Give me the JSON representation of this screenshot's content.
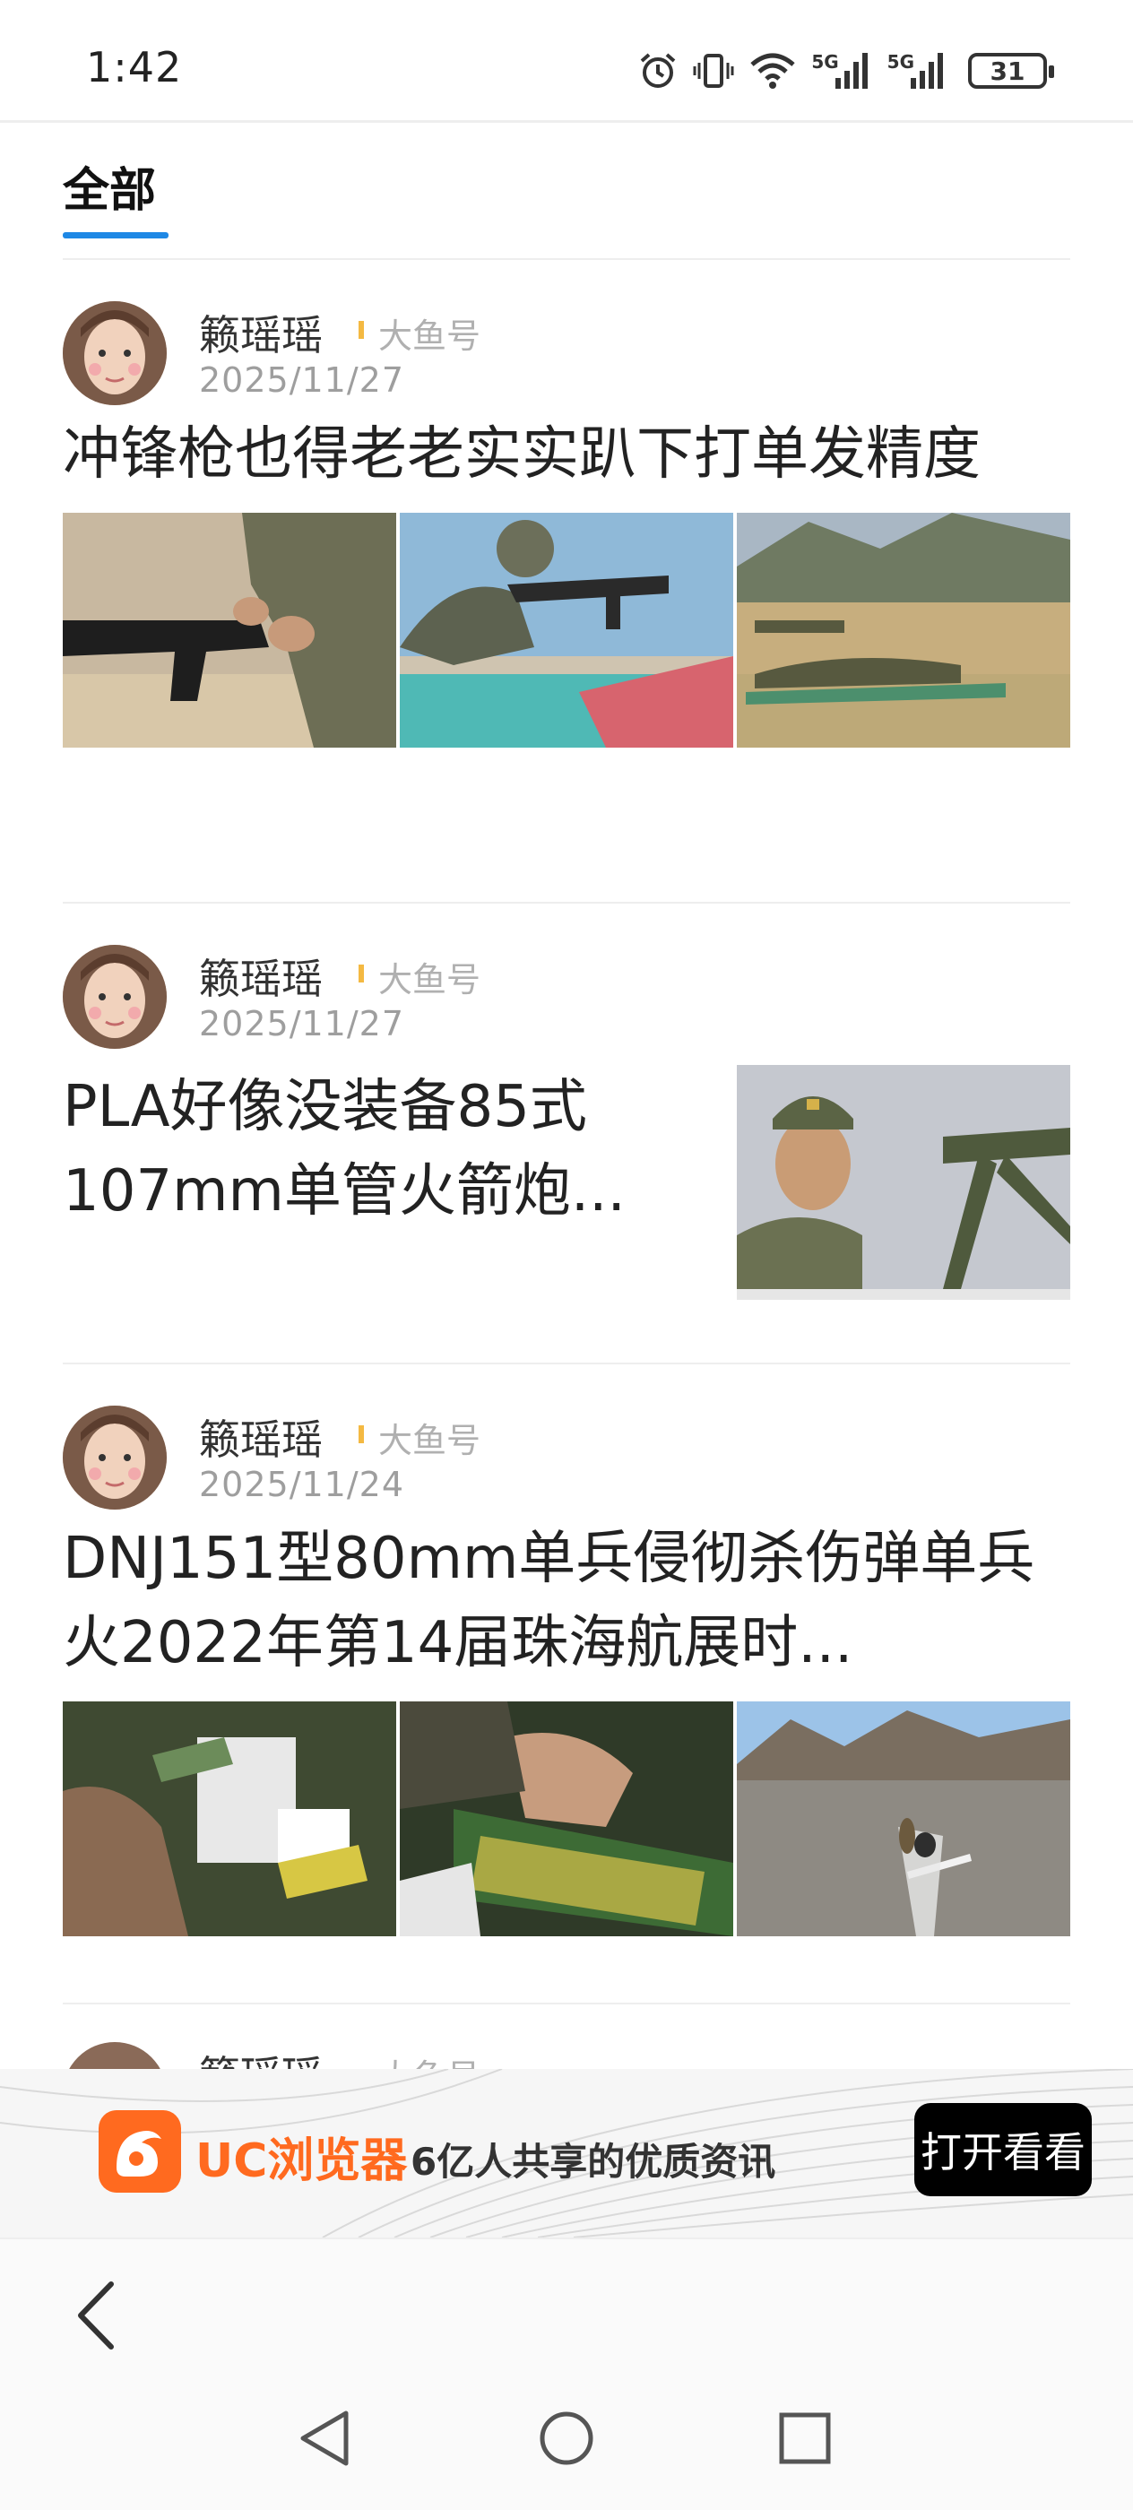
{
  "status_bar": {
    "time": "1:42",
    "battery": "31",
    "network1": "5G",
    "network2": "5G"
  },
  "tab": {
    "label": "全部"
  },
  "cards": [
    {
      "author": "籁瑶瑶",
      "source": "大鱼号",
      "date": "2025/11/27",
      "title": "冲锋枪也得老老实实趴下打单发精度"
    },
    {
      "author": "籁瑶瑶",
      "source": "大鱼号",
      "date": "2025/11/27",
      "title": "PLA好像没装备85式107mm单管火箭炮..."
    },
    {
      "author": "籁瑶瑶",
      "source": "大鱼号",
      "date": "2025/11/24",
      "title": "DNJ151型80mm单兵侵彻杀伤弹单兵火2022年第14届珠海航展时..."
    }
  ],
  "peek_card": {
    "author": "籁瑶瑶",
    "source": "大鱼号"
  },
  "banner": {
    "app_name": "UC浏览器",
    "slogan": "6亿人共享的优质资讯",
    "button": "打开看看"
  },
  "icons": {
    "alarm": "alarm-icon",
    "vibrate": "vibrate-icon",
    "wifi": "wifi-icon",
    "signal": "signal-icon",
    "battery": "battery-icon",
    "back": "chevron-left-icon",
    "nav_back": "triangle-back-icon",
    "nav_home": "circle-home-icon",
    "nav_recent": "square-recent-icon"
  },
  "colors": {
    "accent": "#1e88e5",
    "uc_orange": "#ff6a1f",
    "source_bar": "#f4b942"
  }
}
